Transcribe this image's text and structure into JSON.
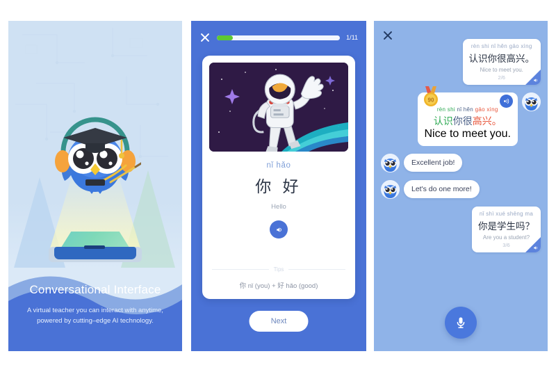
{
  "panel1": {
    "name": "onboarding-slide",
    "title": "Conversational Interface",
    "subtitle_line1": "A virtual teacher you can interact with anytime,",
    "subtitle_line2": "powered by cutting–edge AI technology.",
    "mascot": "owl-teacher-illustration",
    "colors": {
      "background": "#cfe1f3",
      "wave": "#4a72d6",
      "title": "#ffffff"
    }
  },
  "panel2": {
    "name": "lesson-card-screen",
    "close_icon": "close-icon",
    "progress": {
      "current": 1,
      "total": 11,
      "label": "1/11",
      "percent": 13,
      "fill_color": "#5ec832"
    },
    "card": {
      "image": "astronaut-waving-illustration",
      "pinyin": "nǐ hǎo",
      "hanzi": "你 好",
      "english": "Hello",
      "speaker_icon": "speaker-icon",
      "tips_label": "Tips",
      "tip_text": "你 nǐ (you) + 好 hǎo (good)"
    },
    "next_label": "Next",
    "colors": {
      "background": "#4a72d6",
      "card": "#ffffff",
      "accent": "#4a72d6"
    }
  },
  "panel3": {
    "name": "conversation-screen",
    "close_icon": "close-icon",
    "mic_icon": "microphone-icon",
    "messages": [
      {
        "id": "teacher-prompt-1",
        "side": "right",
        "type": "lesson",
        "pinyin": "rèn shi nǐ hěn gāo xìng",
        "hanzi": "认识你很高兴。",
        "english": "Nice to meet you.",
        "counter": "2/6",
        "sound_icon": "speaker-icon"
      },
      {
        "id": "user-answer-scored",
        "side": "right",
        "type": "scored",
        "score": "90",
        "badge_icon": "medal-icon",
        "sound_icon": "sound-wave-icon",
        "avatar": "owl-avatar",
        "pinyin_parts": [
          {
            "text": "rèn shi ",
            "color": "green"
          },
          {
            "text": "nǐ hěn ",
            "color": "blue"
          },
          {
            "text": "gāo xìng",
            "color": "orange"
          }
        ],
        "hanzi_parts": [
          {
            "text": "认识",
            "color": "green"
          },
          {
            "text": "你很",
            "color": "blue"
          },
          {
            "text": "高兴。",
            "color": "orange"
          }
        ],
        "english": "Nice to meet you."
      },
      {
        "id": "teacher-praise",
        "side": "left",
        "type": "plain",
        "avatar": "owl-avatar",
        "text": "Excellent job!"
      },
      {
        "id": "teacher-continue",
        "side": "left",
        "type": "plain",
        "avatar": "owl-avatar",
        "text": "Let's do one more!"
      },
      {
        "id": "teacher-prompt-2",
        "side": "right",
        "type": "lesson",
        "pinyin": "nǐ shì xué shēng ma",
        "hanzi": "你是学生吗？",
        "english": "Are you a student?",
        "counter": "3/6",
        "sound_icon": "speaker-icon"
      }
    ],
    "colors": {
      "background": "#8fb3e8",
      "bubble": "#ffffff",
      "mic": "#4a78dd",
      "green": "#2faa54",
      "blue": "#4a5f86",
      "orange": "#e8553a"
    }
  }
}
